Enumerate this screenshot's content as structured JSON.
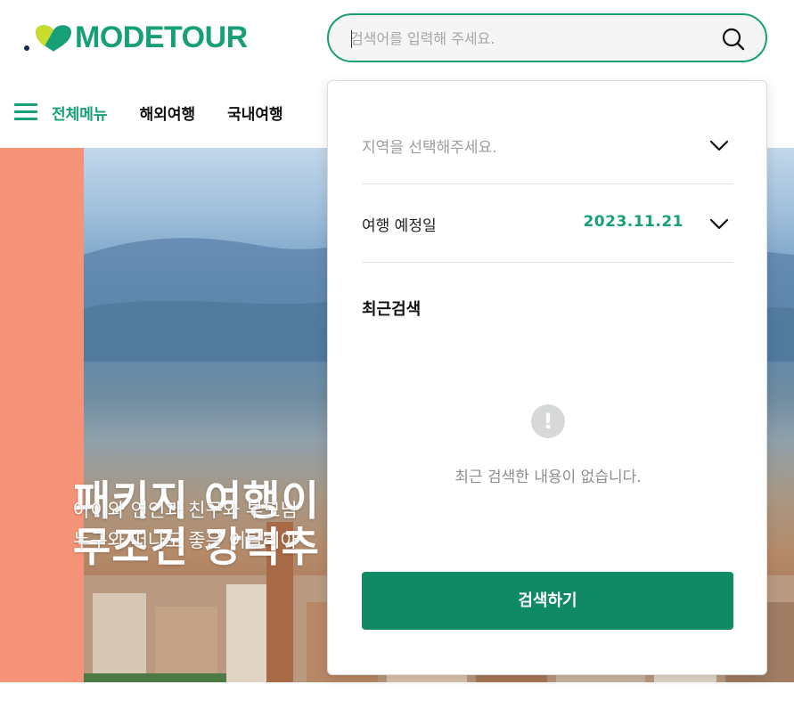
{
  "brand": {
    "name": "MODETOUR",
    "color": "#17a078",
    "accent_button": "#0f8a65"
  },
  "search": {
    "placeholder": "검색어를 입력해 주세요.",
    "value": "",
    "icon": "search-icon"
  },
  "nav": {
    "menu_label": "전체메뉴",
    "items": [
      "해외여행",
      "국내여행"
    ]
  },
  "hero": {
    "title_line1": "패키지 여행이",
    "title_line2": "무조건 강력추",
    "sub_line1": "아이와 연인과 친구와 부모님",
    "sub_line2": "누구와 떠나도 좋은 이탈리아"
  },
  "panel": {
    "region_placeholder": "지역을 선택해주세요.",
    "date_label": "여행 예정일",
    "date_value": "2023.11.21",
    "recent_title": "최근검색",
    "empty_icon": "!",
    "empty_message": "최근 검색한 내용이 없습니다.",
    "submit_label": "검색하기"
  }
}
